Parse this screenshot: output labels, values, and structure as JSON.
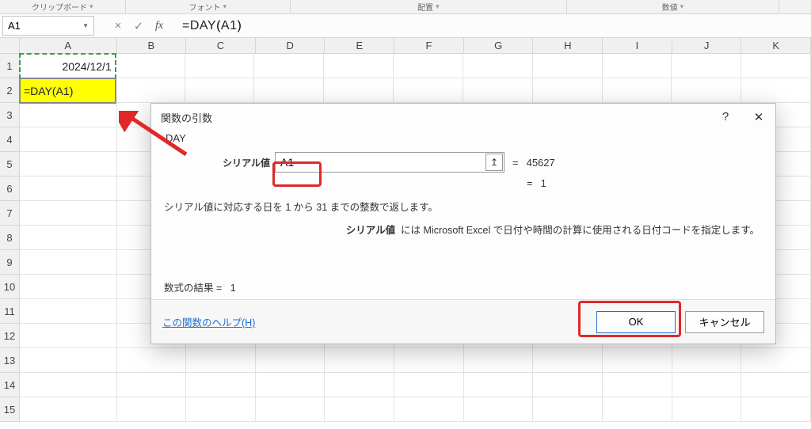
{
  "ribbon": {
    "group1": "クリップボード",
    "group2": "フォント",
    "group3": "配置",
    "group4": "数値"
  },
  "namebox": {
    "value": "A1"
  },
  "formulabar": {
    "cancel": "×",
    "enter": "✓",
    "fx": "fx",
    "prefix": "=DAY",
    "open": "(",
    "arg": "A1",
    "close": ")"
  },
  "columns": [
    "A",
    "B",
    "C",
    "D",
    "E",
    "F",
    "G",
    "H",
    "I",
    "J",
    "K"
  ],
  "rows": [
    "1",
    "2",
    "3",
    "4",
    "5",
    "6",
    "7",
    "8",
    "9",
    "10",
    "11",
    "12",
    "13",
    "14",
    "15"
  ],
  "cells": {
    "a1": "2024/12/1",
    "a2": "=DAY(A1)"
  },
  "dialog": {
    "title": "関数の引数",
    "help_btn": "?",
    "close_btn": "✕",
    "func_name": "DAY",
    "arg_label": "シリアル値",
    "arg_value": "A1",
    "arg_ref_icon": "↥",
    "eq": "=",
    "serial_result": "45627",
    "func_result": "1",
    "desc1": "シリアル値に対応する日を 1 から 31 までの整数で返します。",
    "desc2_bold": "シリアル値",
    "desc2_rest": "には Microsoft Excel で日付や時間の計算に使用される日付コードを指定します。",
    "formula_result_label": "数式の結果 = ",
    "formula_result_value": "1",
    "help_link": "この関数のヘルプ(H)",
    "ok": "OK",
    "cancel": "キャンセル"
  }
}
